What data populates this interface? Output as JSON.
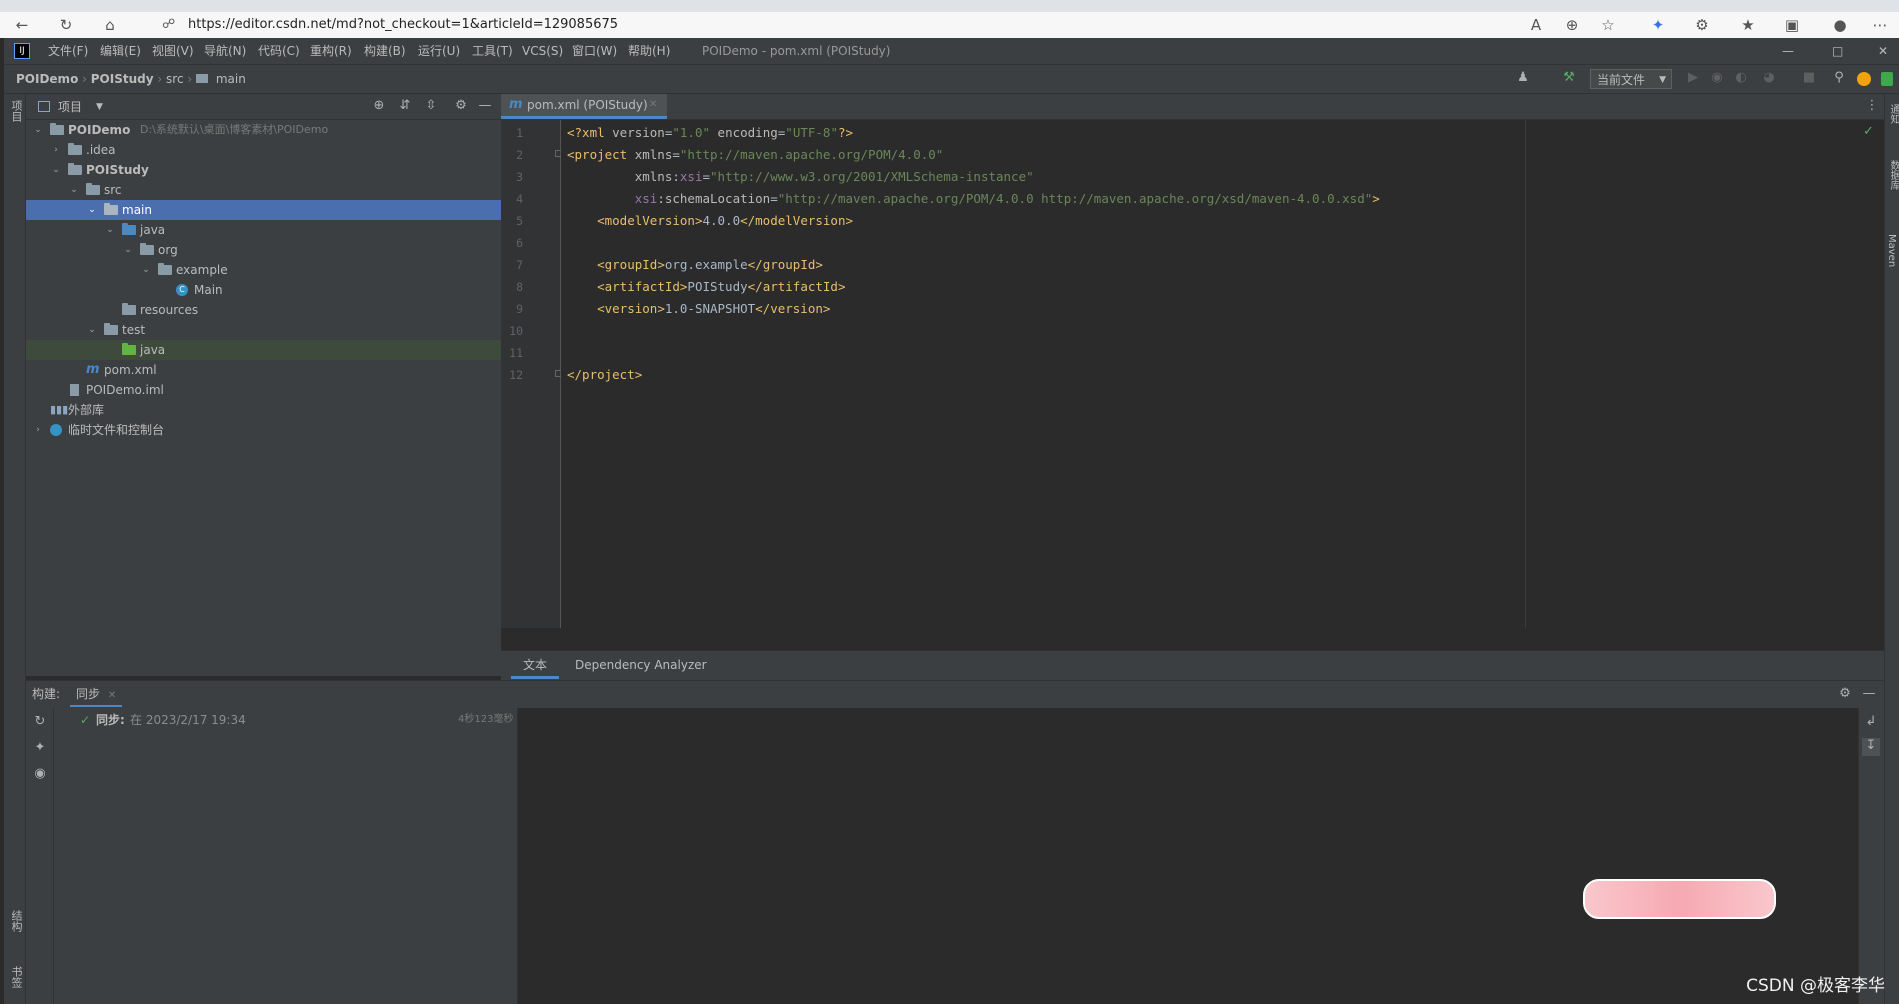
{
  "browser": {
    "url": "https://editor.csdn.net/md?not_checkout=1&articleId=129085675"
  },
  "ide": {
    "menu": [
      "文件(F)",
      "编辑(E)",
      "视图(V)",
      "导航(N)",
      "代码(C)",
      "重构(R)",
      "构建(B)",
      "运行(U)",
      "工具(T)",
      "VCS(S)",
      "窗口(W)",
      "帮助(H)"
    ],
    "window_title": "POIDemo - pom.xml (POIStudy)",
    "breadcrumb": [
      "POIDemo",
      "POIStudy",
      "src",
      "main"
    ],
    "run_config": "当前文件"
  },
  "project_panel": {
    "title": "项目",
    "tree": [
      {
        "label": "POIDemo",
        "hint": "D:\\系统默认\\桌面\\博客素材\\POIDemo",
        "bold": true
      },
      {
        "label": ".idea"
      },
      {
        "label": "POIStudy",
        "bold": true
      },
      {
        "label": "src"
      },
      {
        "label": "main"
      },
      {
        "label": "java"
      },
      {
        "label": "org"
      },
      {
        "label": "example"
      },
      {
        "label": "Main"
      },
      {
        "label": "resources"
      },
      {
        "label": "test"
      },
      {
        "label": "java"
      },
      {
        "label": "pom.xml"
      },
      {
        "label": "POIDemo.iml"
      },
      {
        "label": "外部库"
      },
      {
        "label": "临时文件和控制台"
      }
    ]
  },
  "editor": {
    "tab_label": "pom.xml (POIStudy)",
    "line_numbers": [
      "1",
      "2",
      "3",
      "4",
      "5",
      "6",
      "7",
      "8",
      "9",
      "10",
      "11",
      "12"
    ],
    "bottom_tabs": [
      "文本",
      "Dependency Analyzer"
    ]
  },
  "build_panel": {
    "label": "构建:",
    "tab": "同步",
    "sync_status": "同步:",
    "sync_time": "在 2023/2/17 19:34",
    "duration": "4秒123毫秒"
  },
  "side_labels": {
    "left_top": "项目",
    "left_structure": "结构",
    "left_bookmarks": "书签",
    "right_notifications": "通知",
    "right_database": "数据库",
    "right_maven": "Maven"
  },
  "watermark": "CSDN @极客李华",
  "colors": {
    "selection": "#4b6eaf",
    "editor_bg": "#2b2b2b",
    "panel_bg": "#3c3f41",
    "tag": "#e8bf6a",
    "string": "#6a8759"
  }
}
